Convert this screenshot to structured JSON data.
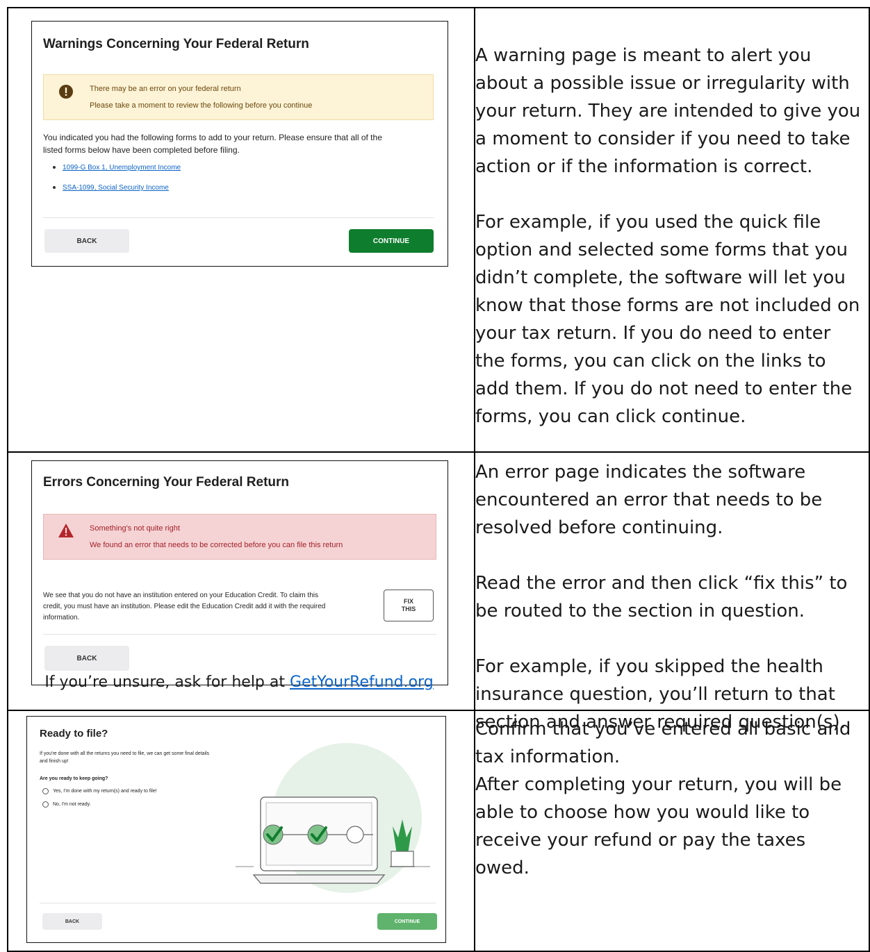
{
  "row1": {
    "shot": {
      "title": "Warnings Concerning Your Federal Return",
      "alert_line1": "There may be an error on your federal return",
      "alert_line2": "Please take a moment to review the following before you continue",
      "body_line1": "You indicated you had the following forms to add to your return. Please ensure that all of the",
      "body_line2": "listed forms below have been completed before filing.",
      "links": [
        "1099-G Box 1, Unemployment Income",
        "SSA-1099, Social Security Income"
      ],
      "back_label": "BACK",
      "continue_label": "CONTINUE"
    },
    "paragraphs": [
      "A warning page is meant to alert you about a possible issue or irregularity with your return. They are intended to give you a moment to consider if you need to take action or if the information is correct.",
      "For example, if you used the quick file option and selected some forms that you didn’t complete, the software will let you know that those forms are not included on your tax return. If you do need to enter the forms, you can click on the links to add them. If you do not need to enter the forms, you can click continue."
    ]
  },
  "row2": {
    "shot": {
      "title": "Errors Concerning Your Federal Return",
      "alert_line1": "Something's not quite right",
      "alert_line2": "We found an error that needs to be corrected before you can file this return",
      "body_line1": "We see that you do not have an institution entered on your Education Credit. To claim this",
      "body_line2": "credit, you must have an institution. Please edit the Education Credit add it with the required",
      "body_line3": "information.",
      "fix_line1": "FIX",
      "fix_line2": "THIS",
      "back_label": "BACK"
    },
    "help_prefix": "If you’re unsure, ask for help at ",
    "help_link": "GetYourRefund.org",
    "paragraphs": [
      "An error page indicates the software encountered an error that needs to be resolved before continuing.",
      "Read the error and then click “fix this” to be routed to the section  in question.",
      "For example, if you skipped the health insurance question, you’ll return to that section and answer required question(s)."
    ]
  },
  "row3": {
    "shot": {
      "title": "Ready to file?",
      "intro_line1": "If you're done with all the returns you need to file, we can get some final details",
      "intro_line2": "and finish up!",
      "question": "Are you ready to keep going?",
      "options": [
        "Yes, I'm done with my return(s) and ready to file!",
        "No, I'm not ready."
      ],
      "back_label": "BACK",
      "continue_label": "CONTINUE"
    },
    "paragraphs": [
      "Confirm that you’ve entered all basic and tax information.",
      "After completing your return, you will be able to choose how you would like to receive your refund or pay the taxes owed."
    ]
  },
  "colors": {
    "link": "#0b63c8",
    "primary_green": "#0f7d2e",
    "light_green": "#5fb36c",
    "warning_bg": "#fdf3d6",
    "error_bg": "#f5d3d4",
    "error_icon": "#b3262b"
  }
}
